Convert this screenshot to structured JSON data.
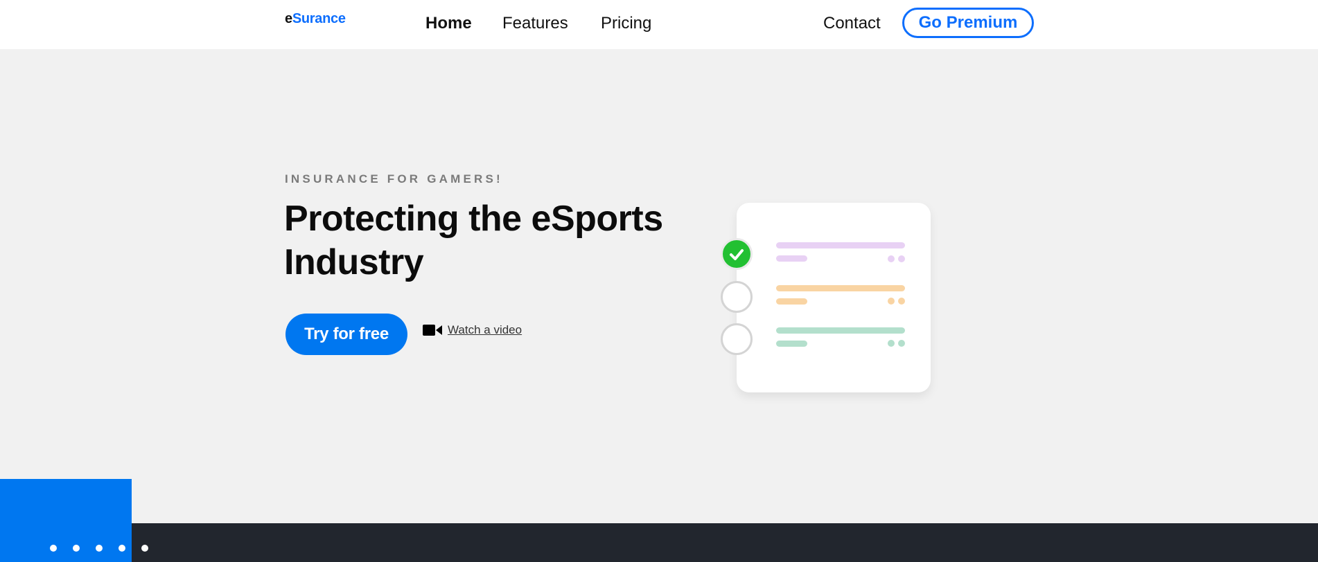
{
  "nav": {
    "logo_prefix": "e",
    "logo_rest": "Surance",
    "links": [
      {
        "label": "Home"
      },
      {
        "label": "Features"
      },
      {
        "label": "Pricing"
      }
    ],
    "contact_label": "Contact",
    "premium_label": "Go Premium"
  },
  "hero": {
    "eyebrow": "INSURANCE FOR GAMERS!",
    "title": "Protecting the eSports Industry",
    "cta_label": "Try for free",
    "video_label": "Watch a video"
  },
  "checklist_colors": {
    "purple": "#e8d1f4",
    "orange": "#f9d4a3",
    "green": "#b3dfcc",
    "check_green": "#22c032"
  },
  "colors": {
    "accent": "#0077f0",
    "footer": "#22262e"
  }
}
